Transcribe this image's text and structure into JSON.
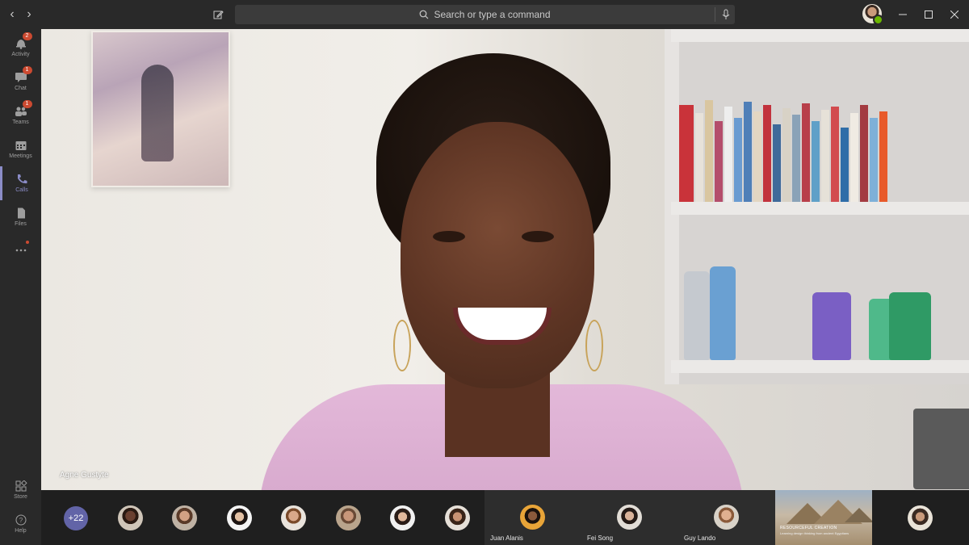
{
  "search": {
    "placeholder": "Search or type a command"
  },
  "rail": [
    {
      "label": "Activity",
      "badge": "2"
    },
    {
      "label": "Chat",
      "badge": "1"
    },
    {
      "label": "Teams",
      "badge": "1"
    },
    {
      "label": "Meetings",
      "badge": ""
    },
    {
      "label": "Calls",
      "badge": ""
    },
    {
      "label": "Files",
      "badge": ""
    },
    {
      "label": "Store",
      "badge": ""
    },
    {
      "label": "Help",
      "badge": ""
    }
  ],
  "call": {
    "active_speaker": "Agne Gustyte"
  },
  "roster": {
    "overflow_count": "+22",
    "tiles": [
      {
        "name": "Juan Alanis"
      },
      {
        "name": "Fei Song"
      },
      {
        "name": "Guy Lando"
      }
    ],
    "shared_content": {
      "title": "RESOURCEFUL CREATION",
      "subtitle": "Learning design thinking from ancient Egyptians"
    }
  },
  "colors": {
    "accent": "#6264a7",
    "badge": "#cc4a31",
    "presence": "#6bb700"
  }
}
